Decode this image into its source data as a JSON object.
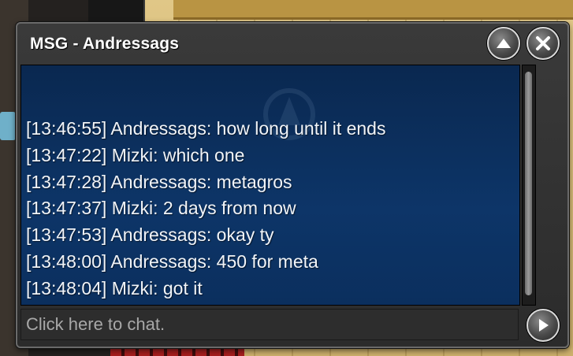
{
  "window": {
    "title": "MSG - Andressags",
    "minimize_icon": "chevron-up-icon",
    "close_icon": "close-icon"
  },
  "messages": [
    {
      "text": "[13:46:55] Andressags: how long until it ends"
    },
    {
      "text": "[13:47:22] Mizki: which one"
    },
    {
      "text": "[13:47:28] Andressags: metagros"
    },
    {
      "text": "[13:47:37] Mizki: 2 days from now"
    },
    {
      "text": "[13:47:53] Andressags: okay ty"
    },
    {
      "text": "[13:48:00] Andressags: 450 for meta"
    },
    {
      "text": "[13:48:04] Mizki: got it"
    }
  ],
  "input": {
    "placeholder": "Click here to chat.",
    "value": ""
  },
  "send_icon": "play-arrow-icon",
  "colors": {
    "pane": "#0d3568",
    "frame": "#2b2b2b",
    "text": "#f1f4f8"
  }
}
